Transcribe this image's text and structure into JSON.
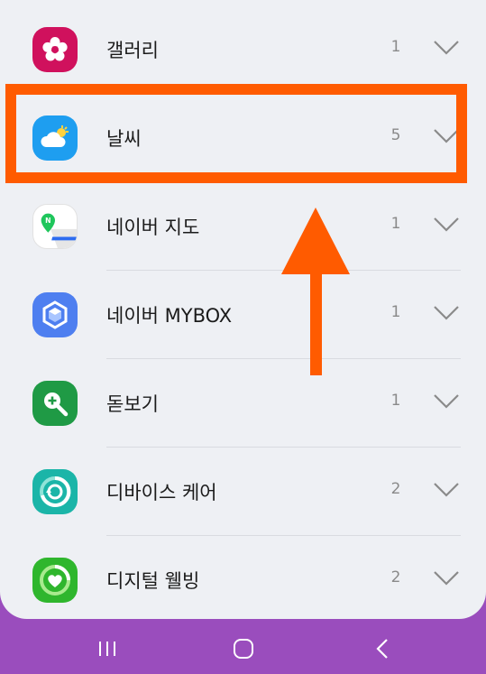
{
  "apps": [
    {
      "name": "갤러리",
      "count": "1",
      "icon": "gallery-flower-icon",
      "color": "#d0115d"
    },
    {
      "name": "날씨",
      "count": "5",
      "icon": "weather-cloud-sun-icon",
      "color": "#1e9ef0"
    },
    {
      "name": "네이버 지도",
      "count": "1",
      "icon": "naver-map-icon",
      "color": "#ffffff"
    },
    {
      "name": "네이버 MYBOX",
      "count": "1",
      "icon": "naver-mybox-cube-icon",
      "color": "#4e7ff0"
    },
    {
      "name": "돋보기",
      "count": "1",
      "icon": "magnifier-plus-icon",
      "color": "#1f9a45"
    },
    {
      "name": "디바이스 케어",
      "count": "2",
      "icon": "device-care-icon",
      "color": "#1bb5a8"
    },
    {
      "name": "디지털 웰빙",
      "count": "2",
      "icon": "digital-wellbeing-heart-icon",
      "color": "#2fb62d"
    }
  ],
  "annotation": {
    "highlight_color": "#ff5b00"
  },
  "navbar": {
    "background": "#9a4dbd",
    "icons": [
      "recent-apps-icon",
      "home-icon",
      "back-icon"
    ]
  }
}
